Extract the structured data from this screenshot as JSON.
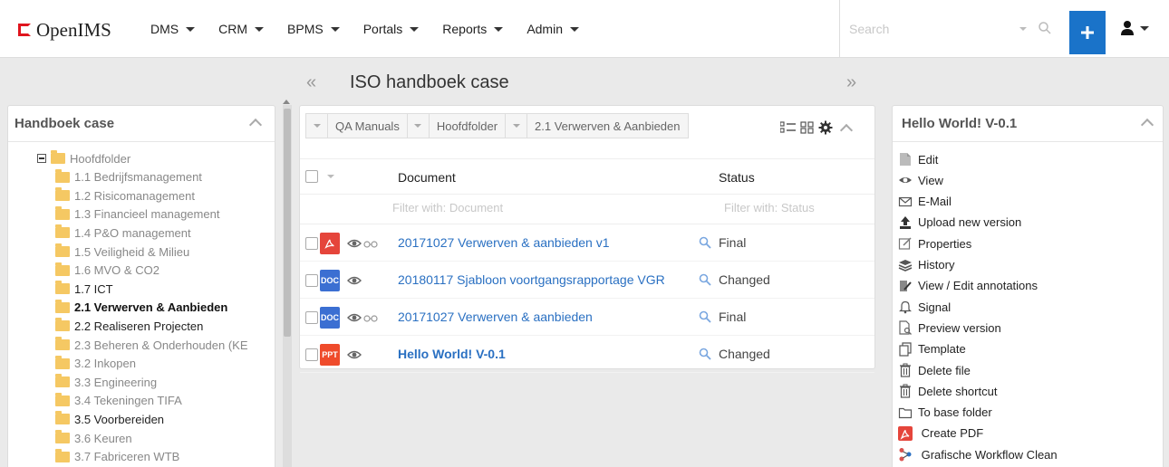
{
  "navbar": {
    "logo_text": "OpenIMS",
    "menu": [
      "DMS",
      "CRM",
      "BPMS",
      "Portals",
      "Reports",
      "Admin"
    ],
    "search_placeholder": "Search"
  },
  "page": {
    "title": "ISO handboek case",
    "prev": "«",
    "next": "»"
  },
  "left_panel": {
    "title": "Handboek case",
    "tree": [
      {
        "label": "Hoofdfolder",
        "style": "normal",
        "level": 0
      },
      {
        "label": "1.1 Bedrijfsmanagement",
        "style": "normal",
        "level": 1
      },
      {
        "label": "1.2 Risicomanagement",
        "style": "normal",
        "level": 1
      },
      {
        "label": "1.3 Financieel management",
        "style": "normal",
        "level": 1
      },
      {
        "label": "1.4 P&O management",
        "style": "normal",
        "level": 1
      },
      {
        "label": "1.5 Veiligheid & Milieu",
        "style": "normal",
        "level": 1
      },
      {
        "label": "1.6 MVO & CO2",
        "style": "normal",
        "level": 1
      },
      {
        "label": "1.7 ICT",
        "style": "dark",
        "level": 1
      },
      {
        "label": "2.1 Verwerven & Aanbieden",
        "style": "bold",
        "level": 1
      },
      {
        "label": "2.2 Realiseren Projecten",
        "style": "dark",
        "level": 1
      },
      {
        "label": "2.3 Beheren & Onderhouden (KE",
        "style": "normal",
        "level": 1
      },
      {
        "label": "3.2 Inkopen",
        "style": "normal",
        "level": 1
      },
      {
        "label": "3.3 Engineering",
        "style": "normal",
        "level": 1
      },
      {
        "label": "3.4 Tekeningen TIFA",
        "style": "normal",
        "level": 1
      },
      {
        "label": "3.5 Voorbereiden",
        "style": "dark",
        "level": 1
      },
      {
        "label": "3.6 Keuren",
        "style": "normal",
        "level": 1
      },
      {
        "label": "3.7 Fabriceren WTB",
        "style": "normal",
        "level": 1
      }
    ]
  },
  "center_panel": {
    "breadcrumbs": [
      "QA Manuals",
      "Hoofdfolder",
      "2.1 Verwerven & Aanbieden"
    ],
    "columns": {
      "document": "Document",
      "status": "Status"
    },
    "filters": {
      "document": "Filter with: Document",
      "status": "Filter with: Status"
    },
    "rows": [
      {
        "type": "pdf",
        "icon_label": "",
        "name": "20171027 Verwerven & aanbieden v1",
        "status": "Final",
        "linked": true,
        "bold": false
      },
      {
        "type": "doc",
        "icon_label": "DOC",
        "name": "20180117 Sjabloon voortgangsrapportage VGR",
        "status": "Changed",
        "linked": false,
        "bold": false
      },
      {
        "type": "doc",
        "icon_label": "DOC",
        "name": "20171027 Verwerven & aanbieden",
        "status": "Final",
        "linked": true,
        "bold": false
      },
      {
        "type": "ppt",
        "icon_label": "PPT",
        "name": "Hello World! V-0.1",
        "status": "Changed",
        "linked": false,
        "bold": true
      }
    ]
  },
  "right_panel": {
    "title": "Hello World! V-0.1",
    "actions": [
      {
        "label": "Edit",
        "icon": "edit-icon"
      },
      {
        "label": "View",
        "icon": "eye-icon"
      },
      {
        "label": "E-Mail",
        "icon": "mail-icon"
      },
      {
        "label": "Upload new version",
        "icon": "upload-icon"
      },
      {
        "label": "Properties",
        "icon": "properties-icon"
      },
      {
        "label": "History",
        "icon": "history-icon"
      },
      {
        "label": "View / Edit annotations",
        "icon": "annotations-icon"
      },
      {
        "label": "Signal",
        "icon": "bell-icon"
      },
      {
        "label": "Preview version",
        "icon": "preview-icon"
      },
      {
        "label": "Template",
        "icon": "template-icon"
      },
      {
        "label": "Delete file",
        "icon": "trash-icon"
      },
      {
        "label": "Delete shortcut",
        "icon": "trash-icon"
      },
      {
        "label": "To base folder",
        "icon": "folder-icon"
      },
      {
        "label": " Create PDF",
        "icon": "pdf-icon"
      },
      {
        "label": " Grafische Workflow Clean",
        "icon": "workflow-icon"
      }
    ]
  },
  "colors": {
    "accent": "#1a73c9",
    "link": "#2a70c2",
    "logo": "#e0151e",
    "folder": "#f5c863"
  }
}
